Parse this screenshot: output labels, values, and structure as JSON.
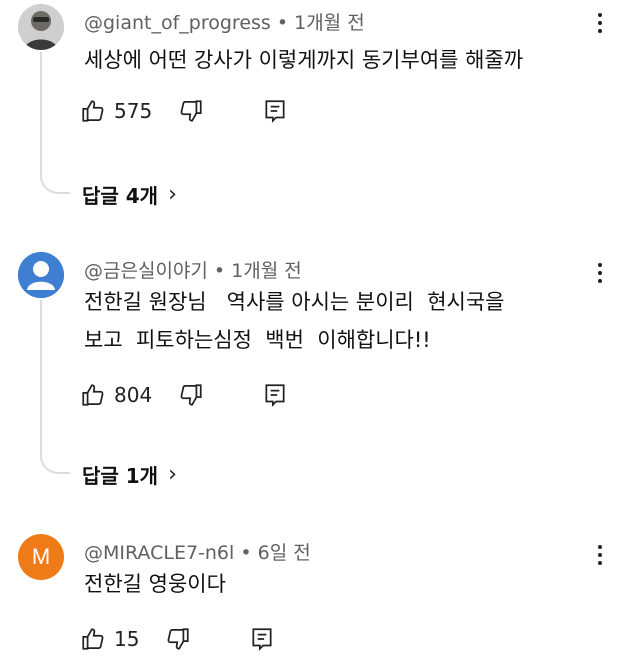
{
  "comments": [
    {
      "handle": "@giant_of_progress",
      "separator": " • ",
      "time": "1개월 전",
      "text": "세상에 어떤 강사가 이렇게까지 동기부여를 해줄까",
      "likes": "575",
      "replies_label": "답글 4개",
      "avatar": "photo-avatar"
    },
    {
      "handle": "@금은실이야기",
      "separator": " • ",
      "time": "1개월 전",
      "text_line1": "전한길 원장님   역사를 아시는 분이리  현시국을",
      "text_line2": "보고  피토하는심정  백번  이해합니다!!",
      "likes": "804",
      "replies_label": "답글 1개",
      "avatar": "default-avatar"
    },
    {
      "handle": "@MIRACLE7-n6l",
      "separator": " • ",
      "time": "6일 전",
      "text": "전한길 영웅이다",
      "likes": "15",
      "avatar_letter": "M"
    }
  ],
  "icons": {
    "like": "thumbs-up-icon",
    "dislike": "thumbs-down-icon",
    "reply": "reply-icon",
    "more": "more-vert-icon",
    "chevron": "chevron-right-icon"
  },
  "chevron_glyph": "›"
}
